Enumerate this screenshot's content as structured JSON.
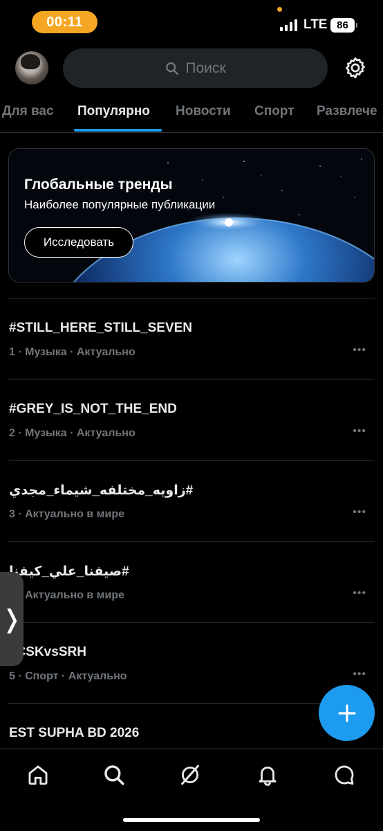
{
  "status_bar": {
    "time": "00:11",
    "network": "LTE",
    "battery": "86"
  },
  "search": {
    "placeholder": "Поиск"
  },
  "tabs": [
    {
      "label": "Для вас"
    },
    {
      "label": "Популярно"
    },
    {
      "label": "Новости"
    },
    {
      "label": "Спорт"
    },
    {
      "label": "Развлече"
    }
  ],
  "active_tab": "Популярно",
  "promo": {
    "title": "Глобальные тренды",
    "subtitle": "Наиболее популярные публикации",
    "button": "Исследовать"
  },
  "trends": [
    {
      "name": "#STILL_HERE_STILL_SEVEN",
      "meta": "1 · Музыка · Актуально"
    },
    {
      "name": "#GREY_IS_NOT_THE_END",
      "meta": "2 · Музыка · Актуально"
    },
    {
      "name": "#زاويه_مختلفه_شيماء_مجدي",
      "meta": "3 · Актуально в мире"
    },
    {
      "name": "#صيفنا_علي_كيفنا",
      "meta": "4 · Актуально в мире"
    },
    {
      "name": "#CSKvsSRH",
      "meta": "5 · Спорт · Актуально"
    },
    {
      "name": "EST SUPHA BD 2026",
      "meta": ""
    }
  ],
  "more_glyph": "•••",
  "side_handle_glyph": "❭",
  "icons": {
    "avatar": "profile-photo",
    "search": "search-icon",
    "settings": "gear-icon",
    "fab": "plus-icon",
    "nav": [
      "home-icon",
      "search-icon",
      "grok-icon",
      "bell-icon",
      "chat-icon"
    ]
  },
  "colors": {
    "accent": "#1d9bf0",
    "time_pill": "#f5a623",
    "background": "#000000",
    "muted": "#71767b"
  }
}
